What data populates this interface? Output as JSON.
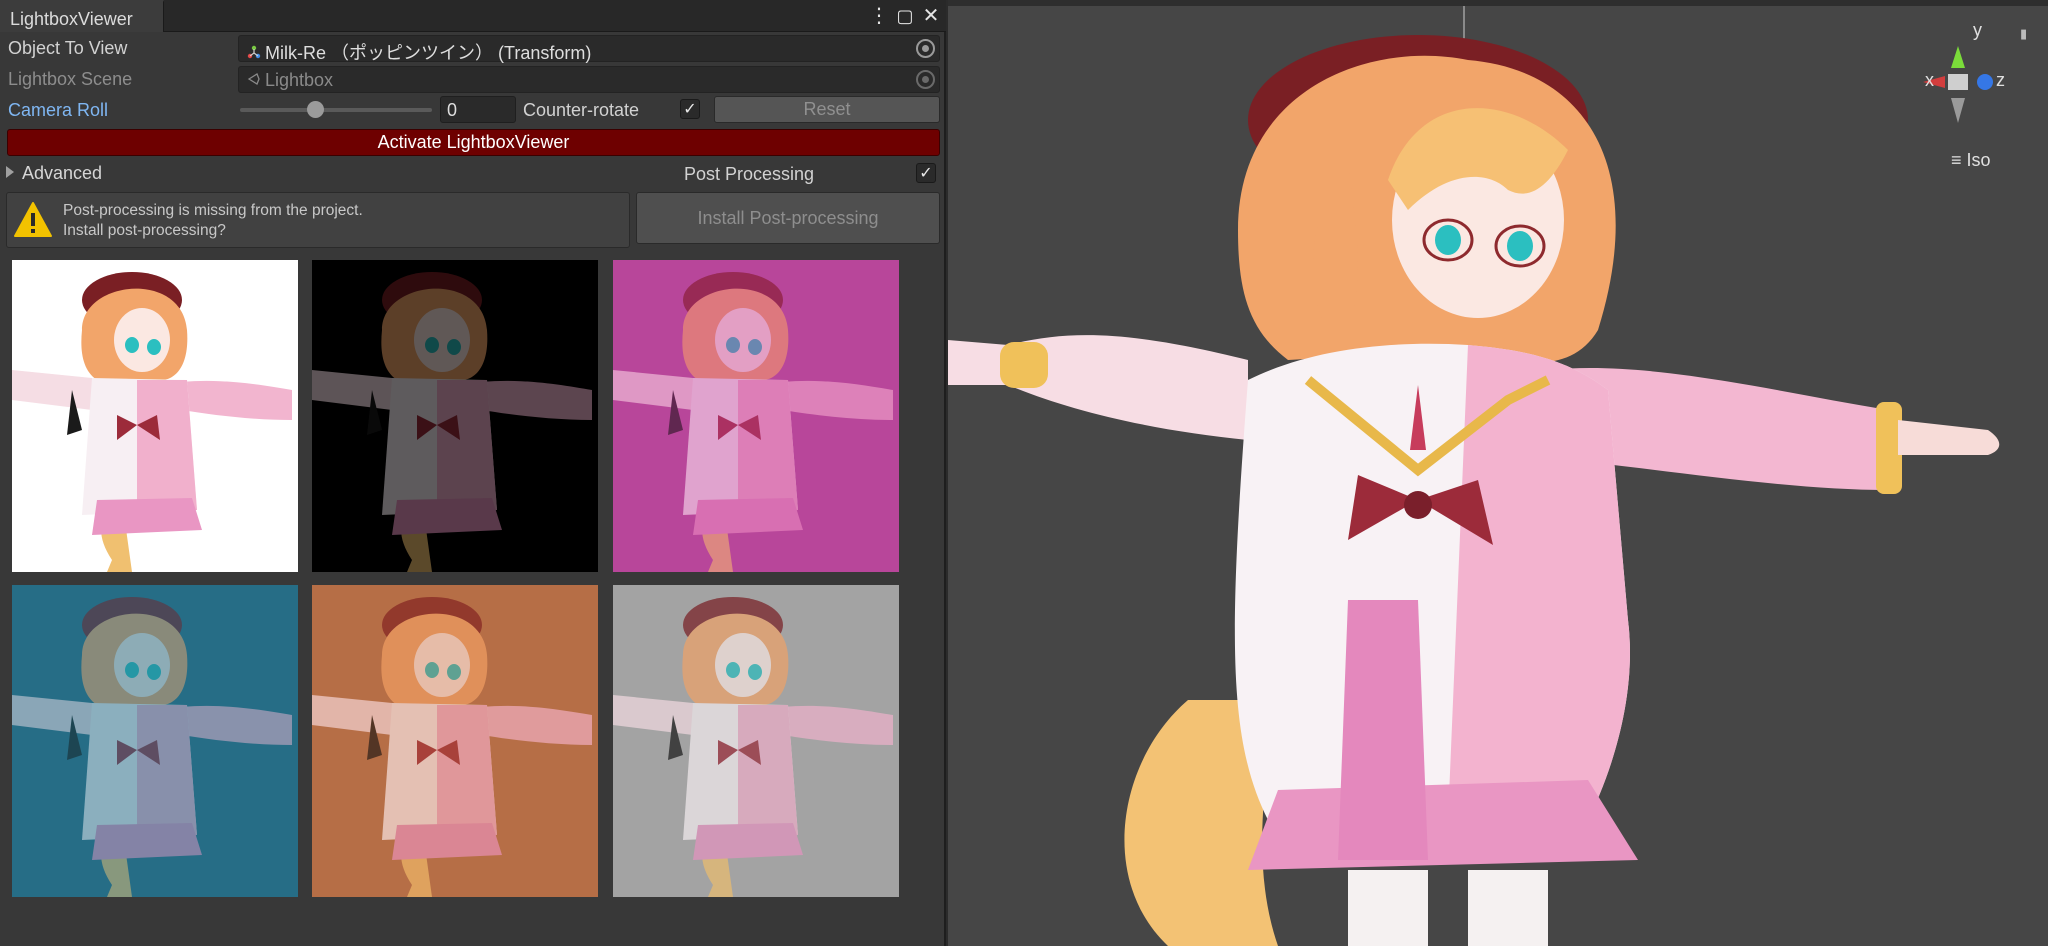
{
  "window": {
    "tab_title": "LightboxViewer",
    "controls": {
      "menu": "⋮",
      "maximize": "▢",
      "close": "✕"
    }
  },
  "fields": {
    "object_to_view_label": "Object To View",
    "object_to_view_value": "Milk-Re （ポッピンツイン） (Transform)",
    "lightbox_scene_label": "Lightbox Scene",
    "lightbox_scene_value": "Lightbox",
    "camera_roll_label": "Camera Roll",
    "camera_roll_value": "0",
    "camera_roll_fraction": 0.39,
    "counter_rotate_label": "Counter-rotate",
    "counter_rotate_checked": true,
    "reset_label": "Reset",
    "activate_label": "Activate LightboxViewer",
    "advanced_label": "Advanced",
    "post_processing_label": "Post Processing",
    "post_processing_checked": true
  },
  "help": {
    "line1": "Post-processing is missing from the project.",
    "line2": "Install post-processing?",
    "install_label": "Install Post-processing"
  },
  "thumbnails": [
    {
      "name": "thumbnail-white",
      "bg": "#ffffff",
      "tint": "#ffffff",
      "tint_opacity": 0.0
    },
    {
      "name": "thumbnail-dark",
      "bg": "#000000",
      "tint": "#000000",
      "tint_opacity": 0.62
    },
    {
      "name": "thumbnail-magenta",
      "bg": "#b2509a",
      "tint": "#c03a9c",
      "tint_opacity": 0.42
    },
    {
      "name": "thumbnail-teal",
      "bg": "#2d6a83",
      "tint": "#1f6f8a",
      "tint_opacity": 0.5
    },
    {
      "name": "thumbnail-orange",
      "bg": "#b1714c",
      "tint": "#c06a3c",
      "tint_opacity": 0.35
    },
    {
      "name": "thumbnail-gray",
      "bg": "#a7a7a7",
      "tint": "#9a9a9a",
      "tint_opacity": 0.3
    }
  ],
  "scene": {
    "axis_x": "x",
    "axis_y": "y",
    "axis_z": "z",
    "projection_label": "Iso",
    "menu_icon": "≡",
    "lock_icon": "🔒"
  },
  "colors": {
    "activate_bg": "#6e0000",
    "link": "#7fb6f2",
    "warning": "#f2c200"
  }
}
